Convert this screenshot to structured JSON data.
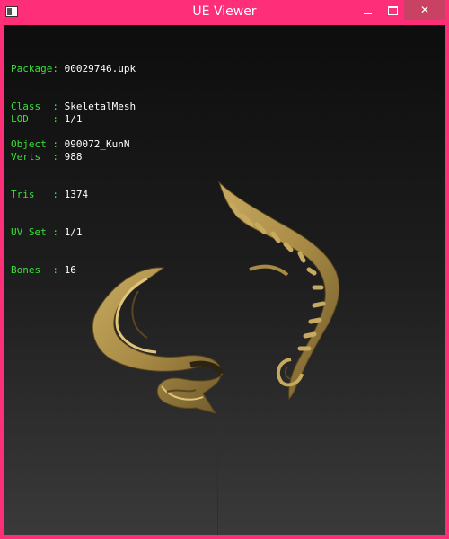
{
  "window": {
    "title": "UE Viewer",
    "accent": "#ff2e78",
    "controls": {
      "minimize_icon": "minimize-icon",
      "maximize_icon": "maximize-icon",
      "close_label": "✕"
    }
  },
  "info": {
    "package_key": "Package:",
    "package_val": "00029746.upk",
    "class_key": "Class  :",
    "class_val": "SkeletalMesh",
    "object_key": "Object :",
    "object_val": "090072_KunN",
    "lod_key": "LOD    :",
    "lod_val": "1/1",
    "verts_key": "Verts  :",
    "verts_val": "988",
    "tris_key": "Tris   :",
    "tris_val": "1374",
    "uvset_key": "UV Set :",
    "uvset_val": "1/1",
    "bones_key": "Bones  :",
    "bones_val": "16",
    "label_color": "#38e138"
  },
  "mesh": {
    "color": "#a88a45"
  }
}
